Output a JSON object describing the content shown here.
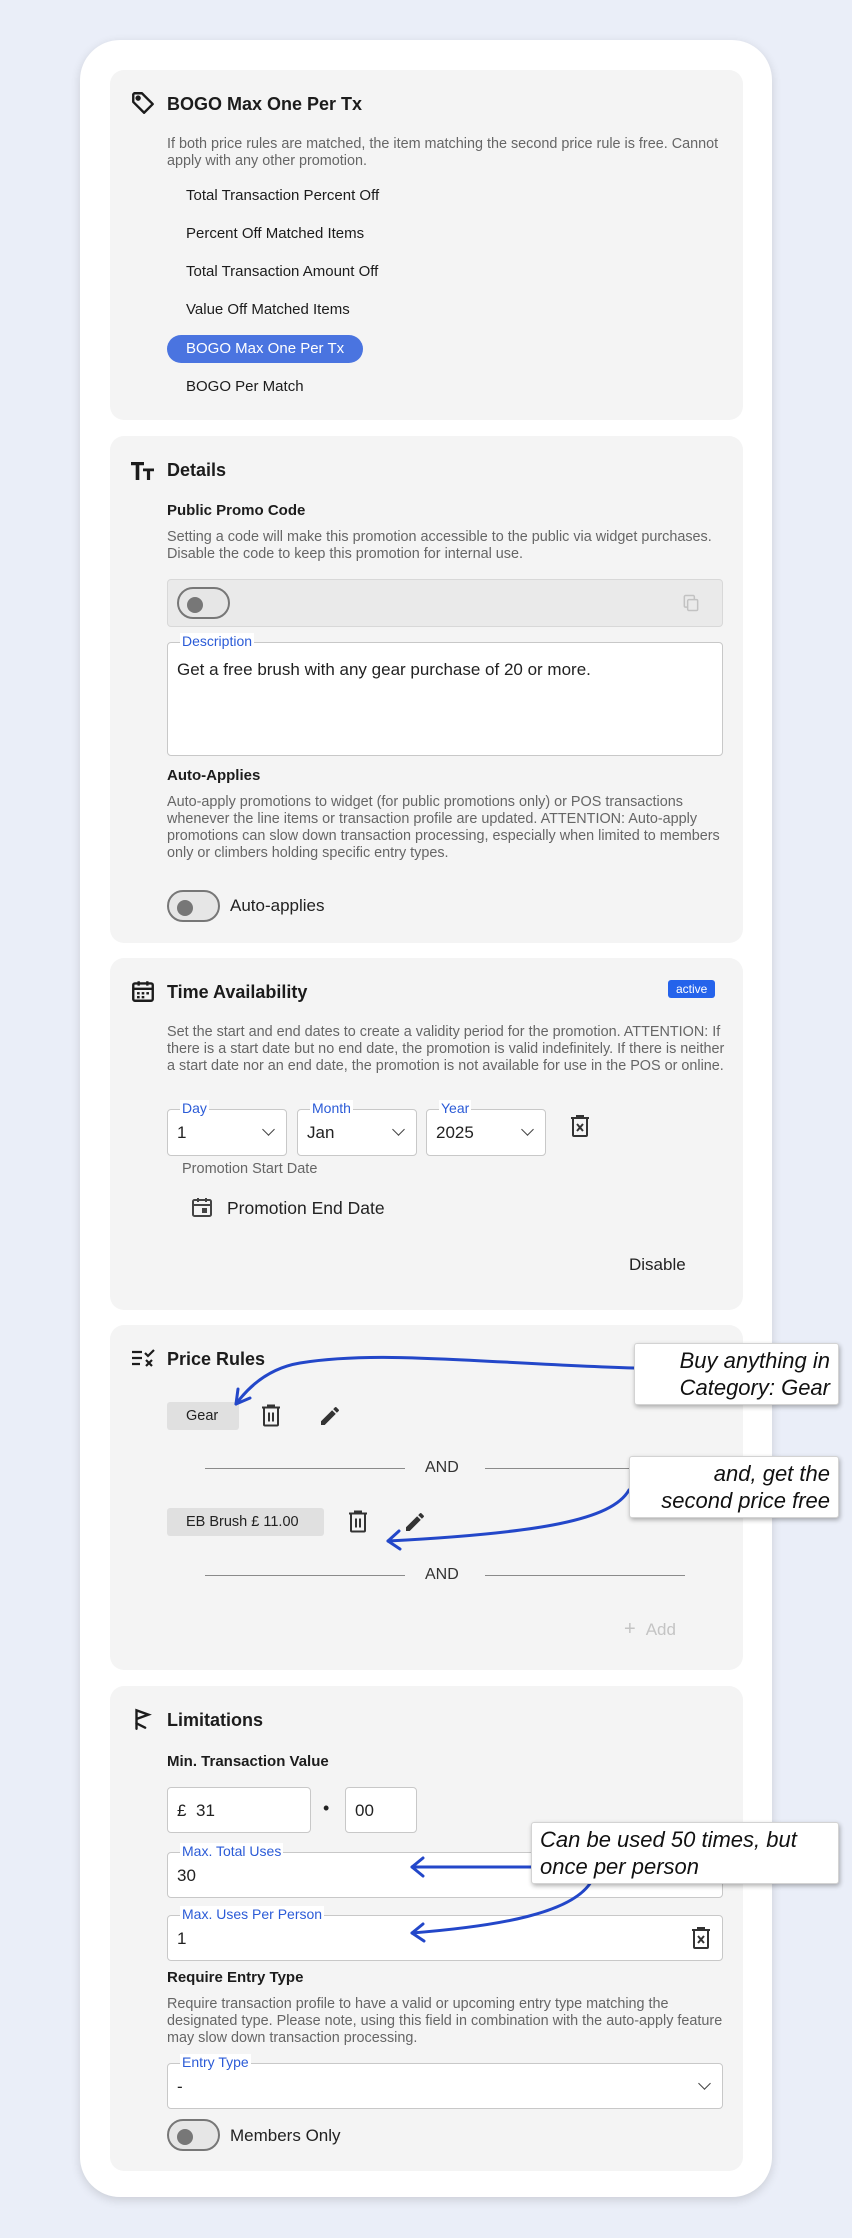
{
  "promotion_type": {
    "title": "BOGO Max One Per Tx",
    "description": "If both price rules are matched, the item matching the second price rule is free. Cannot apply with any other promotion.",
    "options": [
      {
        "label": "Total Transaction Percent Off",
        "selected": false
      },
      {
        "label": "Percent Off Matched Items",
        "selected": false
      },
      {
        "label": "Total Transaction Amount Off",
        "selected": false
      },
      {
        "label": "Value Off Matched Items",
        "selected": false
      },
      {
        "label": "BOGO Max One Per Tx",
        "selected": true
      },
      {
        "label": "BOGO Per Match",
        "selected": false
      }
    ]
  },
  "details": {
    "title": "Details",
    "public_promo_code": {
      "label": "Public Promo Code",
      "description": "Setting a code will make this promotion accessible to the public via widget purchases. Disable the code to keep this promotion for internal use.",
      "enabled": false
    },
    "description_field": {
      "label": "Description",
      "value": "Get a free brush with any gear purchase of 20 or more."
    },
    "auto_applies": {
      "label": "Auto-Applies",
      "description": "Auto-apply promotions to widget (for public promotions only) or POS transactions whenever the line items or transaction profile are updated. ATTENTION: Auto-apply promotions can slow down transaction processing, especially when limited to members only or climbers holding specific entry types.",
      "toggle_label": "Auto-applies",
      "enabled": false
    }
  },
  "time_availability": {
    "title": "Time Availability",
    "status_badge": "active",
    "description": "Set the start and end dates to create a validity period for the promotion. ATTENTION: If there is a start date but no end date, the promotion is valid indefinitely. If there is neither a start date nor an end date, the promotion is not available for use in the POS or online.",
    "start_date": {
      "day_label": "Day",
      "day": "1",
      "month_label": "Month",
      "month": "Jan",
      "year_label": "Year",
      "year": "2025",
      "caption": "Promotion Start Date"
    },
    "end_date_button": "Promotion End Date",
    "disable_button": "Disable"
  },
  "price_rules": {
    "title": "Price Rules",
    "rules": [
      {
        "label": "Gear"
      },
      {
        "label": "EB Brush £ 11.00"
      }
    ],
    "separator": "AND",
    "add_button": "Add"
  },
  "limitations": {
    "title": "Limitations",
    "min_transaction": {
      "label": "Min. Transaction Value",
      "currency": "£",
      "whole": "31",
      "separator": "•",
      "fraction": "00"
    },
    "max_total_uses": {
      "label": "Max. Total Uses",
      "value": "30"
    },
    "max_uses_per_person": {
      "label": "Max. Uses Per Person",
      "value": "1"
    },
    "require_entry_type": {
      "label": "Require Entry Type",
      "description": "Require transaction profile to have a valid or upcoming entry type matching the designated type. Please note, using this field in combination with the auto-apply feature may slow down transaction processing.",
      "field_label": "Entry Type",
      "value": "-"
    },
    "members_only": {
      "label": "Members Only",
      "enabled": false
    }
  },
  "annotations": {
    "rule1": "Buy anything in Category: Gear",
    "rule2": "and, get the second price free",
    "uses": "Can be used 50 times, but once per person"
  },
  "colors": {
    "accent": "#2b5bd7",
    "selected_chip": "#4a74e0",
    "badge": "#2563eb",
    "arrow": "#2347c9",
    "section_bg": "#f4f4f4",
    "page_bg": "#eaeef8"
  }
}
